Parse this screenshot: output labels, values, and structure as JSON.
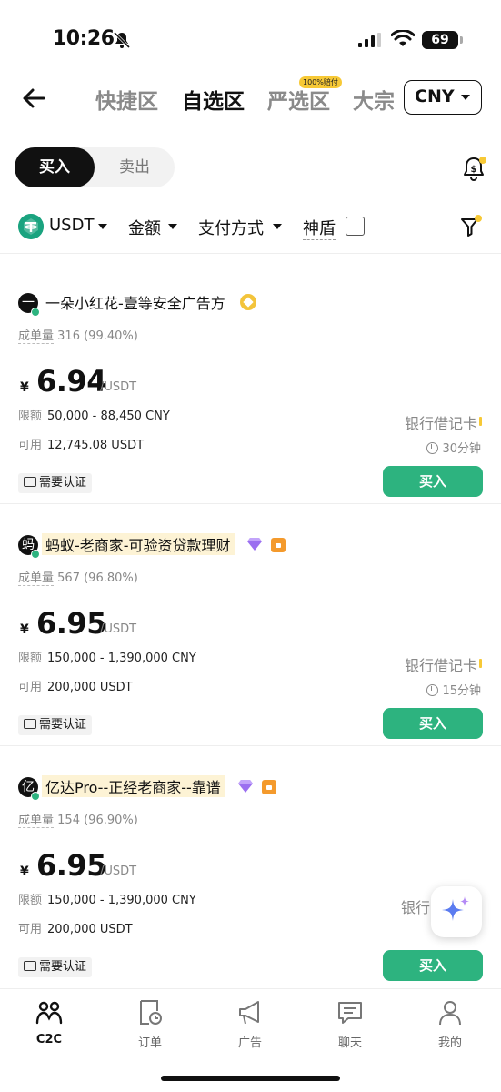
{
  "status_bar": {
    "time": "10:26",
    "battery": "69"
  },
  "nav": {
    "back_icon": "arrow-left-icon",
    "tabs": [
      {
        "label": "快捷区",
        "active": false
      },
      {
        "label": "自选区",
        "active": true
      },
      {
        "label": "严选区",
        "active": false,
        "badge": "100%赔付"
      },
      {
        "label": "大宗",
        "active": false
      }
    ],
    "currency": "CNY"
  },
  "toggle": {
    "buy": "买入",
    "sell": "卖出"
  },
  "filters": {
    "coin": "USDT",
    "amount": "金额",
    "payment": "支付方式",
    "shield": "神盾"
  },
  "listings": [
    {
      "avatar_char": "一",
      "name": "一朵小红花-壹等安全广告方",
      "highlighted": false,
      "stats_label": "成单量",
      "stats_value": "316 (99.40%)",
      "price_symbol": "¥",
      "price": "6.94",
      "price_unit": "/USDT",
      "limit_label": "限额",
      "limit": "50,000 - 88,450 CNY",
      "avail_label": "可用",
      "available": "12,745.08 USDT",
      "payment": "银行借记卡",
      "time_limit": "30分钟",
      "kyc": "需要认证",
      "buy_label": "买入"
    },
    {
      "avatar_char": "蚂",
      "name": "蚂蚁-老商家-可验资贷款理财",
      "highlighted": true,
      "stats_label": "成单量",
      "stats_value": "567 (96.80%)",
      "price_symbol": "¥",
      "price": "6.95",
      "price_unit": "/USDT",
      "limit_label": "限额",
      "limit": "150,000 - 1,390,000 CNY",
      "avail_label": "可用",
      "available": "200,000 USDT",
      "payment": "银行借记卡",
      "time_limit": "15分钟",
      "kyc": "需要认证",
      "buy_label": "买入"
    },
    {
      "avatar_char": "亿",
      "name": "亿达Pro--正经老商家--靠谱",
      "highlighted": true,
      "stats_label": "成单量",
      "stats_value": "154 (96.90%)",
      "price_symbol": "¥",
      "price": "6.95",
      "price_unit": "/USDT",
      "limit_label": "限额",
      "limit": "150,000 - 1,390,000 CNY",
      "avail_label": "可用",
      "available": "200,000 USDT",
      "payment": "银行",
      "time_limit": "",
      "kyc": "需要认证",
      "buy_label": "买入"
    }
  ],
  "tab_bar": [
    {
      "label": "C2C",
      "icon": "people-icon",
      "active": true
    },
    {
      "label": "订单",
      "icon": "order-icon",
      "active": false
    },
    {
      "label": "广告",
      "icon": "megaphone-icon",
      "active": false
    },
    {
      "label": "聊天",
      "icon": "chat-icon",
      "active": false
    },
    {
      "label": "我的",
      "icon": "person-icon",
      "active": false
    }
  ],
  "colors": {
    "accent_green": "#2db37f",
    "badge_yellow": "#f7c936",
    "tether_green": "#1aa37f"
  }
}
